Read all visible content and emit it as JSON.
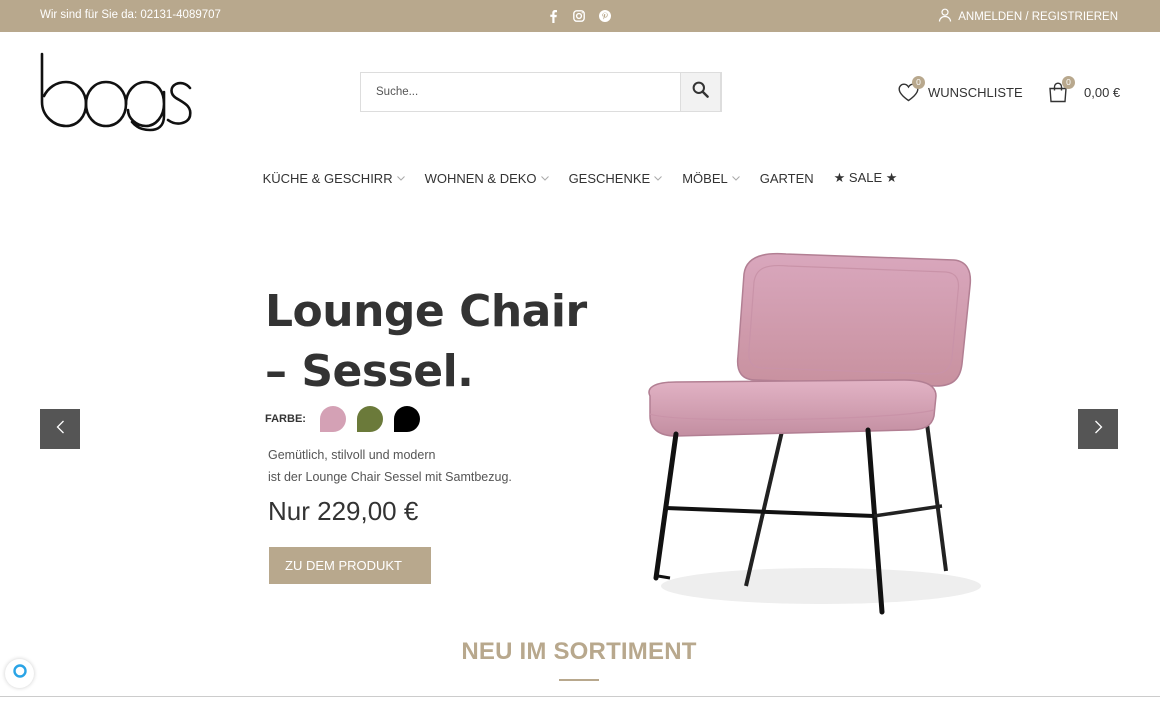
{
  "topbar": {
    "phone": "Wir sind für Sie da: 02131-4089707",
    "social_icons": [
      "facebook-icon",
      "instagram-icon",
      "pinterest-icon"
    ],
    "account_label": "ANMELDEN / REGISTRIEREN"
  },
  "header": {
    "logo_text": "boogs",
    "search_placeholder": "Suche...",
    "wishlist_label": "WUNSCHLISTE",
    "wishlist_count": "0",
    "cart_count": "0",
    "cart_total": "0,00 €"
  },
  "nav": {
    "items": [
      {
        "label": "KÜCHE & GESCHIRR",
        "has_dropdown": true
      },
      {
        "label": "WOHNEN & DEKO",
        "has_dropdown": true
      },
      {
        "label": "GESCHENKE",
        "has_dropdown": true
      },
      {
        "label": "MÖBEL",
        "has_dropdown": true
      },
      {
        "label": "GARTEN",
        "has_dropdown": false
      },
      {
        "label": "★ SALE ★",
        "has_dropdown": false
      }
    ]
  },
  "slide": {
    "title_line1": "Lounge Chair",
    "title_line2": "– Sessel.",
    "color_label": "FARBE:",
    "colors": [
      "#d4a1b5",
      "#6b7a3a",
      "#000000"
    ],
    "desc_line1": "Gemütlich, stilvoll und modern",
    "desc_line2": "ist der Lounge Chair Sessel mit Samtbezug.",
    "price": "Nur 229,00 €",
    "cta": "ZU DEM PRODUKT"
  },
  "section": {
    "title": "NEU IM SORTIMENT"
  },
  "theme": {
    "accent": "#b8a88d",
    "dark": "#333333",
    "arrow_bg": "#555555"
  }
}
